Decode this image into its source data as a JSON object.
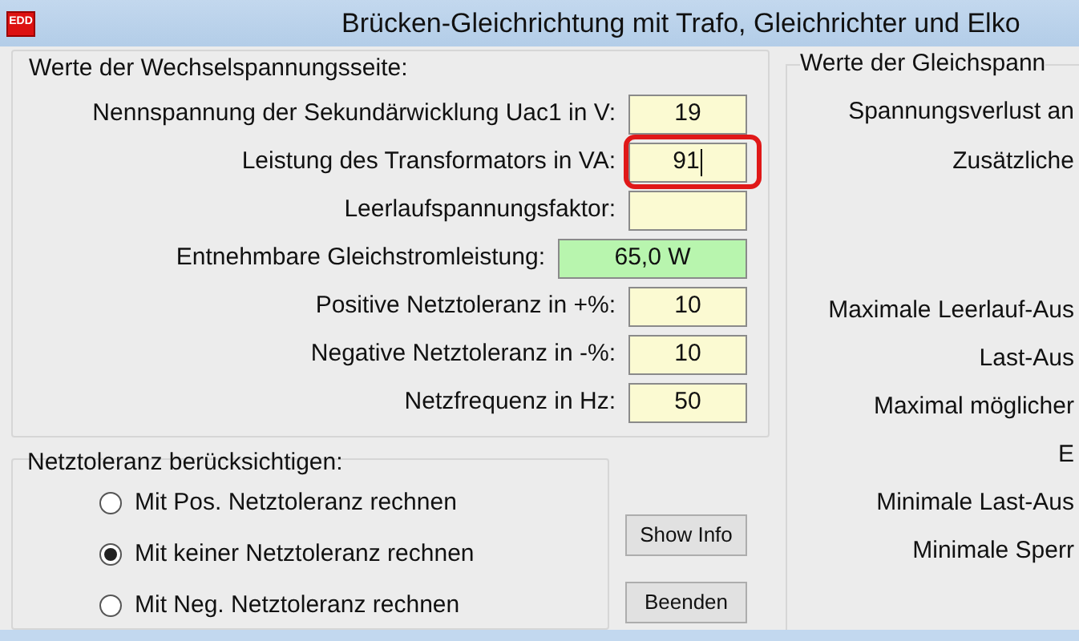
{
  "window": {
    "icon_text": "EDD",
    "title": "Brücken-Gleichrichtung mit Trafo, Gleichrichter und Elko"
  },
  "ac_group": {
    "legend": "Werte der Wechselspannungsseite:",
    "rows": [
      {
        "label": "Nennspannung der Sekundärwicklung Uac1 in V:",
        "value": "19",
        "kind": "input",
        "focused": false,
        "highlighted": false
      },
      {
        "label": "Leistung des Transformators in VA:",
        "value": "91",
        "kind": "input",
        "focused": true,
        "highlighted": true
      },
      {
        "label": "Leerlaufspannungsfaktor:",
        "value": "",
        "kind": "input",
        "focused": false,
        "highlighted": false
      },
      {
        "label": "Entnehmbare Gleichstromleistung:",
        "value": "65,0 W",
        "kind": "result",
        "focused": false,
        "highlighted": false
      },
      {
        "label": "Positive Netztoleranz in +%:",
        "value": "10",
        "kind": "input",
        "focused": false,
        "highlighted": false
      },
      {
        "label": "Negative Netztoleranz in -%:",
        "value": "10",
        "kind": "input",
        "focused": false,
        "highlighted": false
      },
      {
        "label": "Netzfrequenz in Hz:",
        "value": "50",
        "kind": "input",
        "focused": false,
        "highlighted": false
      }
    ]
  },
  "dc_group": {
    "legend": "Werte der Gleichspann",
    "labels_top": [
      "Spannungsverlust an",
      "Zusätzliche"
    ],
    "labels_bottom": [
      "Maximale Leerlauf-Aus",
      "Last-Aus",
      "Maximal möglicher",
      "E",
      "Minimale Last-Aus",
      "Minimale Sperr"
    ]
  },
  "tolerance_group": {
    "legend": "Netztoleranz berücksichtigen:",
    "options": [
      {
        "label": "Mit Pos. Netztoleranz rechnen",
        "selected": false
      },
      {
        "label": "Mit keiner Netztoleranz rechnen",
        "selected": true
      },
      {
        "label": "Mit Neg. Netztoleranz rechnen",
        "selected": false
      }
    ]
  },
  "buttons": [
    "Show Info",
    "Beenden"
  ]
}
